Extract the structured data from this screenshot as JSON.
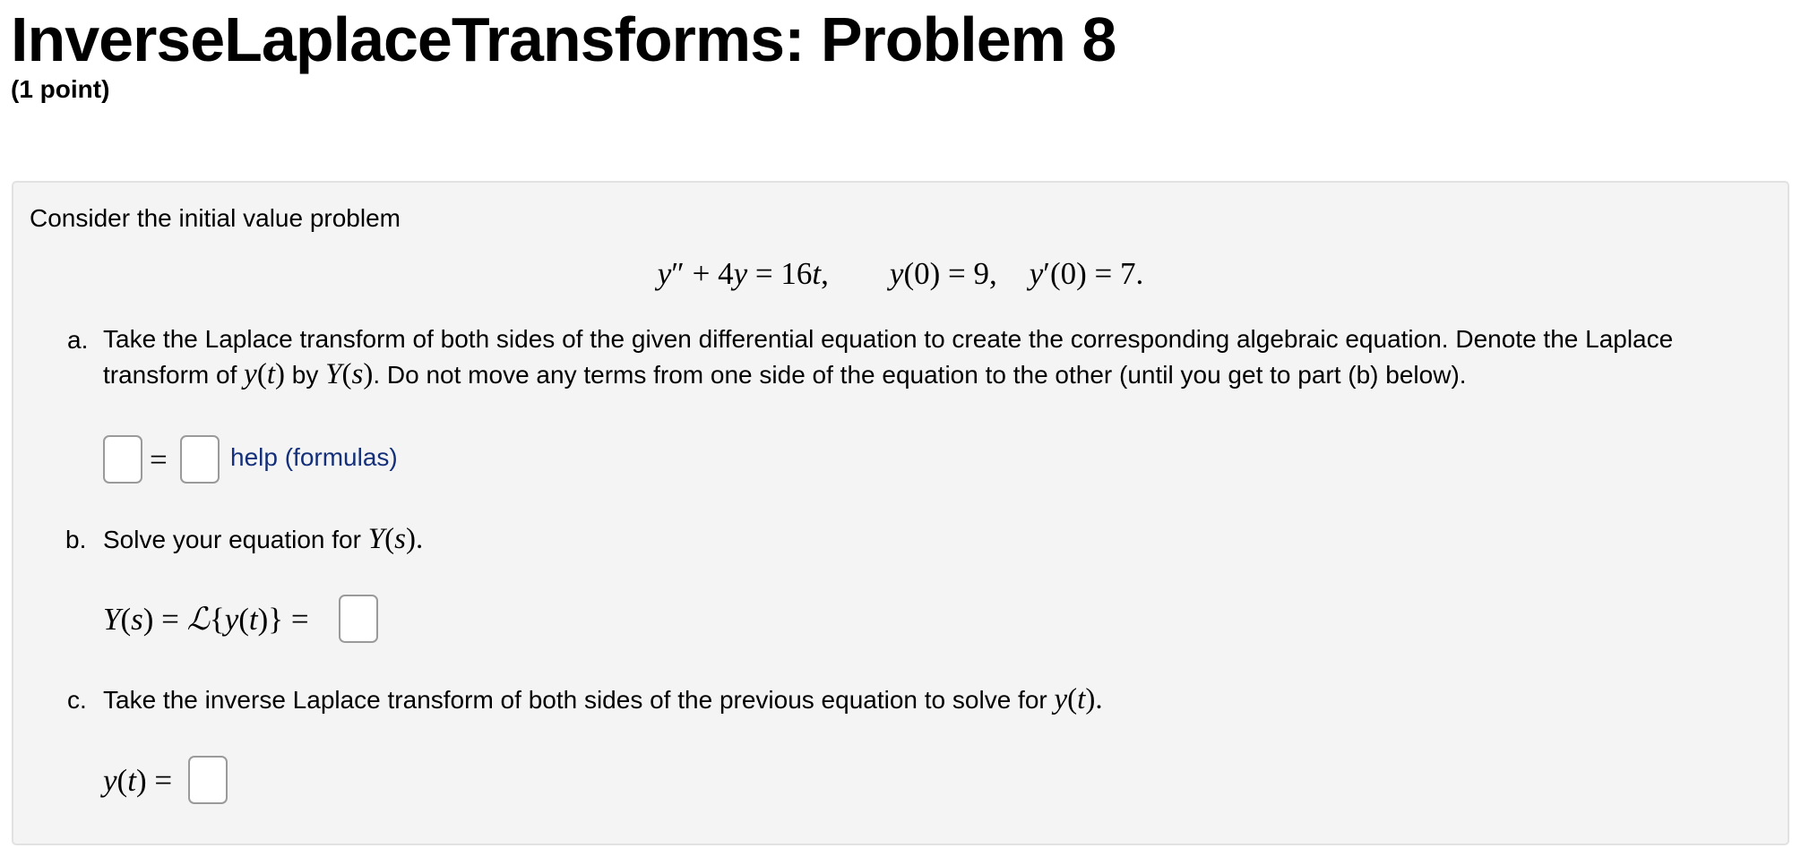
{
  "header": {
    "title": "InverseLaplaceTransforms: Problem 8",
    "points": "(1 point)"
  },
  "problem": {
    "intro": "Consider the initial value problem",
    "part_a": {
      "marker": "a.",
      "line1": "Take the Laplace transform of both sides of the given differential equation to create the corresponding algebraic equation. Denote the Laplace",
      "line2_pre": "transform of",
      "line2_mid": "by",
      "line2_post": ". Do not move any terms from one side of the equation to the other (until you get to part (b) below).",
      "help_link": "help (formulas)"
    },
    "part_b": {
      "marker": "b.",
      "text": "Solve your equation for"
    },
    "part_c": {
      "marker": "c.",
      "text": "Take the inverse Laplace transform of both sides of the previous equation to solve for"
    }
  },
  "answers": {
    "a_left": "",
    "a_right": "",
    "b_Y": "",
    "c_y": ""
  }
}
